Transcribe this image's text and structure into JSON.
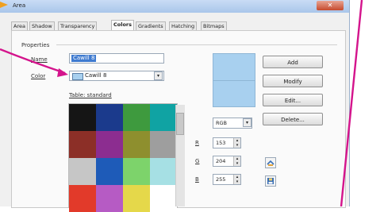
{
  "window": {
    "title": "Area",
    "close_glyph": "✕"
  },
  "tabs": [
    "Area",
    "Shadow",
    "Transparency",
    "Colors",
    "Gradients",
    "Hatching",
    "Bitmaps"
  ],
  "active_tab": "Colors",
  "properties": {
    "group_label": "Properties",
    "name_label": "Name",
    "name_value": "Cawill 8",
    "color_label": "Color",
    "color_value": "Cawill 8",
    "table_label": "Table: standard"
  },
  "palette": [
    [
      "#151515",
      "#1b3a8c",
      "#3e9a3e",
      "#10a3a3"
    ],
    [
      "#8c2f27",
      "#8c2d90",
      "#8e8f2e",
      "#9e9e9e"
    ],
    [
      "#c6c6c6",
      "#1e5bb8",
      "#7dd36b",
      "#a6e0e4"
    ],
    [
      "#e23a2a",
      "#b65bc4",
      "#e5d84a",
      "#ffffff"
    ]
  ],
  "model": {
    "value": "RGB",
    "arrow": "▾"
  },
  "rgb": [
    {
      "label": "R",
      "value": "153"
    },
    {
      "label": "G",
      "value": "204"
    },
    {
      "label": "B",
      "value": "255"
    }
  ],
  "buttons": {
    "add": "Add",
    "modify": "Modify",
    "edit": "Edit...",
    "delete": "Delete..."
  },
  "icons": {
    "load": "load-color-list-icon",
    "save": "save-color-list-icon"
  },
  "colors": {
    "preview": "#a8d0ef",
    "selection": "#3f7bd0",
    "annotation": "#d4148c",
    "title_arrow": "#f0a020"
  }
}
